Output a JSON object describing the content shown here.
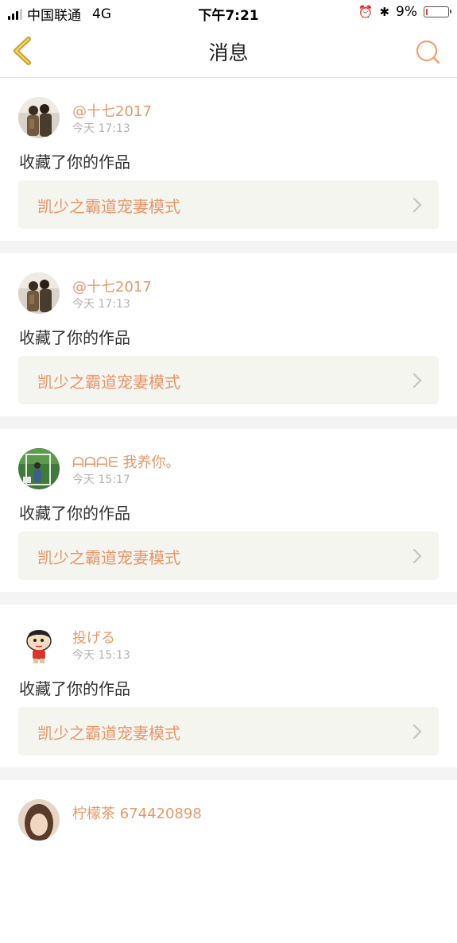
{
  "status_bar": {
    "carrier": "中国联通",
    "network": "4G",
    "time": "下午7:21",
    "battery": "9%",
    "battery_fraction": 0.09,
    "battery_color": "#e23b3b",
    "icons": [
      "alarm-icon",
      "bluetooth-icon"
    ]
  },
  "nav": {
    "title": "消息",
    "back_icon": "chevron-left-icon",
    "search_icon": "search-icon",
    "accent_color": "#c9a227"
  },
  "messages": [
    {
      "user": "@十七2017",
      "time": "今天 17:13",
      "action": "收藏了你的作品",
      "work_title": "凯少之霸道宠妻模式",
      "avatar": "photo-couple"
    },
    {
      "user": "@十七2017",
      "time": "今天 17:13",
      "action": "收藏了你的作品",
      "work_title": "凯少之霸道宠妻模式",
      "avatar": "photo-couple"
    },
    {
      "user": "ᗩᗩᗩᗴ 我养你。",
      "time": "今天 15:17",
      "action": "收藏了你的作品",
      "work_title": "凯少之霸道宠妻模式",
      "avatar": "photo-green"
    },
    {
      "user": "投げる",
      "time": "今天 15:13",
      "action": "收藏了你的作品",
      "work_title": "凯少之霸道宠妻模式",
      "avatar": "cartoon-boy"
    },
    {
      "user": "柠檬茶 674420898",
      "time": "",
      "action": "",
      "work_title": "",
      "avatar": "photo-girl"
    }
  ]
}
